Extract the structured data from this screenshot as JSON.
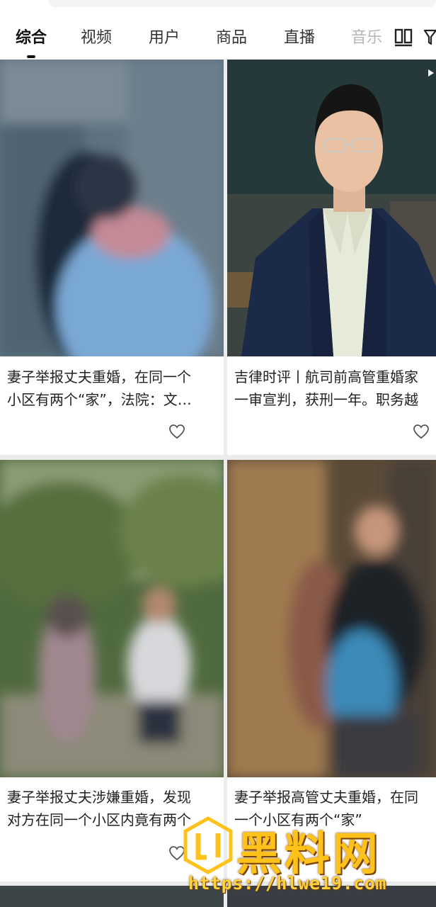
{
  "tabs": [
    {
      "label": "综合",
      "active": true
    },
    {
      "label": "视频",
      "active": false
    },
    {
      "label": "用户",
      "active": false
    },
    {
      "label": "商品",
      "active": false
    },
    {
      "label": "直播",
      "active": false
    },
    {
      "label": "音乐",
      "active": false
    }
  ],
  "toolbar": {
    "layout_icon": "double-column-icon",
    "filter_icon": "filter-icon"
  },
  "cards": [
    {
      "title": "妻子举报丈夫重婚，在同一个\n小区有两个“家”，法院：文…",
      "liked": false
    },
    {
      "title": "吉律时评丨航司前高管重婚家\n一审宣判，获刑一年。职务越",
      "liked": false
    },
    {
      "title": "妻子举报丈夫涉嫌重婚，发现\n对方在同一个小区内竟有两个",
      "liked": false
    },
    {
      "title": "妻子举报高管丈夫重婚，在同\n一个小区有两个“家”",
      "liked": false
    }
  ],
  "watermark": {
    "brand": "黑料网",
    "url": "https://hlwe19.com"
  },
  "colors": {
    "accent": "#ffc21a",
    "text": "#222222",
    "background": "#ececec"
  }
}
